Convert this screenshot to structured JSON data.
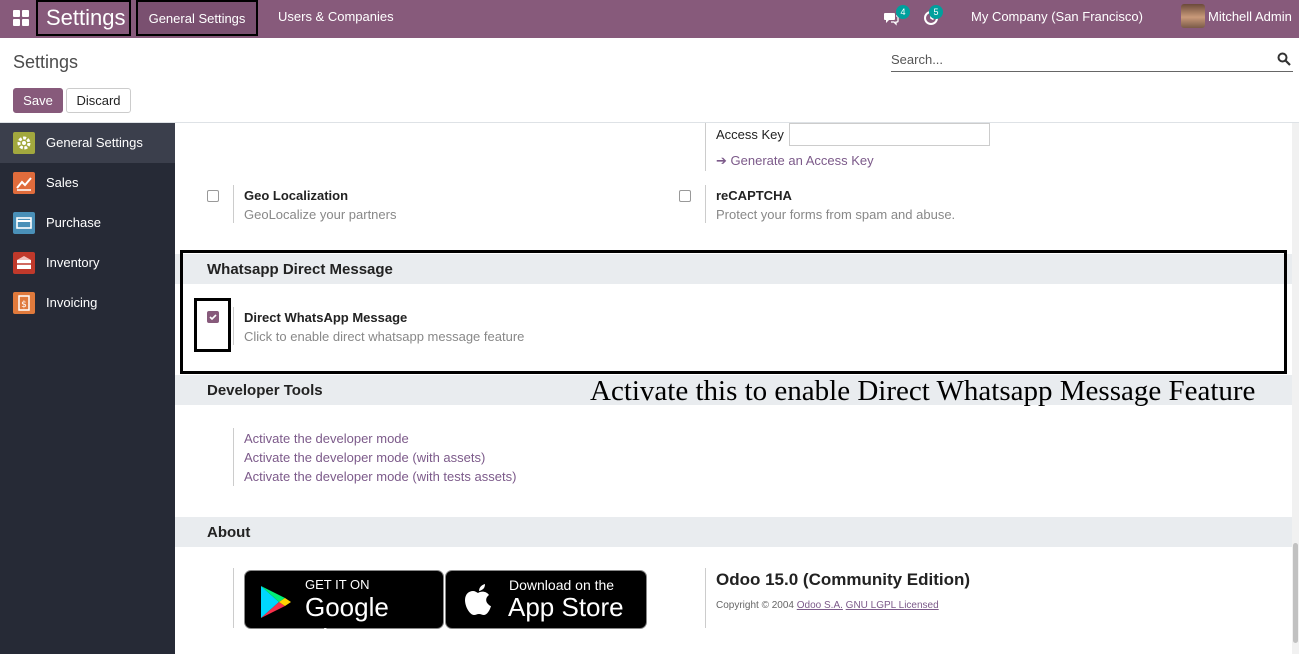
{
  "navbar": {
    "app_title": "Settings",
    "menu": [
      "General Settings",
      "Users & Companies"
    ],
    "messages_count": "4",
    "activities_count": "5",
    "company": "My Company (San Francisco)",
    "user": "Mitchell Admin"
  },
  "control_panel": {
    "title": "Settings",
    "save_label": "Save",
    "discard_label": "Discard",
    "search_placeholder": "Search..."
  },
  "sidebar": {
    "items": [
      {
        "label": "General Settings",
        "icon": "gear-icon",
        "color": "#a2a83e"
      },
      {
        "label": "Sales",
        "icon": "chart-icon",
        "color": "#e06c3c"
      },
      {
        "label": "Purchase",
        "icon": "card-icon",
        "color": "#4a90b8"
      },
      {
        "label": "Inventory",
        "icon": "box-icon",
        "color": "#c0392b"
      },
      {
        "label": "Invoicing",
        "icon": "invoice-icon",
        "color": "#e07a3c"
      }
    ]
  },
  "integrations": {
    "access_key_label": "Access Key",
    "generate_link": "Generate an Access Key",
    "geo": {
      "title": "Geo Localization",
      "desc": "GeoLocalize your partners",
      "checked": false
    },
    "recaptcha": {
      "title": "reCAPTCHA",
      "desc": "Protect your forms from spam and abuse.",
      "checked": false
    }
  },
  "whatsapp": {
    "section_title": "Whatsapp Direct Message",
    "setting_title": "Direct WhatsApp Message",
    "setting_desc": "Click to enable direct whatsapp message feature",
    "checked": true
  },
  "annotation": "Activate this to enable Direct Whatsapp Message Feature",
  "developer": {
    "section_title": "Developer Tools",
    "links": [
      "Activate the developer mode",
      "Activate the developer mode (with assets)",
      "Activate the developer mode (with tests assets)"
    ]
  },
  "about": {
    "section_title": "About",
    "google_small": "GET IT ON",
    "google_big": "Google Play",
    "apple_small": "Download on the",
    "apple_big": "App Store",
    "version": "Odoo 15.0 (Community Edition)",
    "copyright_prefix": "Copyright © 2004",
    "company_link": "Odoo S.A.",
    "license_link": "GNU LGPL Licensed"
  },
  "colors": {
    "brand": "#875a7b",
    "badge": "#00a09d",
    "sidebar_bg": "#262a36"
  }
}
